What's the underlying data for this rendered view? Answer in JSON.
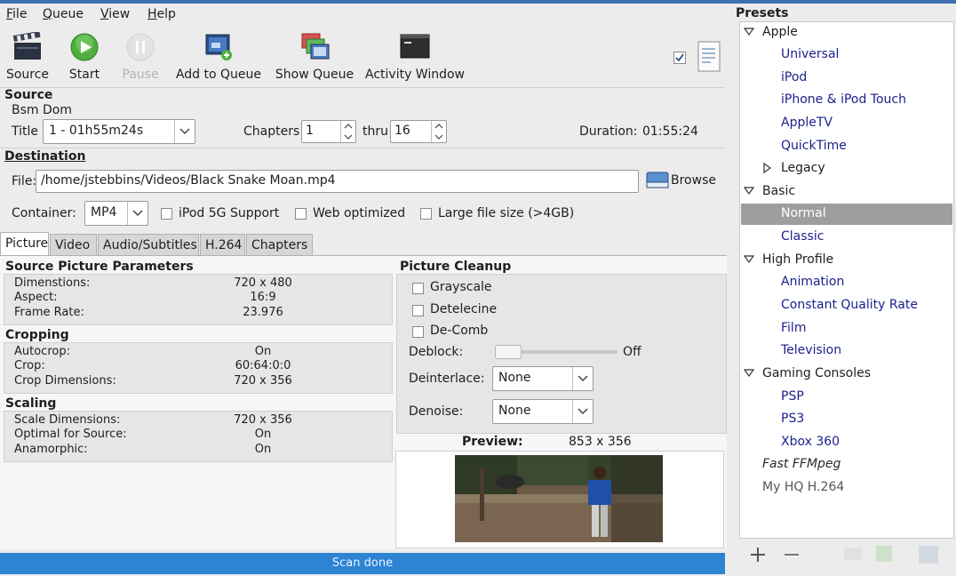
{
  "menu": {
    "file": "File",
    "queue": "Queue",
    "view": "View",
    "help": "Help"
  },
  "toolbar": {
    "source": "Source",
    "start": "Start",
    "pause": "Pause",
    "add_to_queue": "Add to Queue",
    "show_queue": "Show Queue",
    "activity_window": "Activity Window"
  },
  "source": {
    "heading": "Source",
    "name": "Bsm Dom",
    "title_label": "Title",
    "title_value": "1 - 01h55m24s",
    "chapters_label": "Chapters",
    "chapters_from": "1",
    "thru_label": "thru",
    "chapters_to": "16",
    "duration_label": "Duration:",
    "duration_value": "01:55:24"
  },
  "destination": {
    "heading": "Destination",
    "file_label": "File:",
    "file_value": "/home/jstebbins/Videos/Black Snake Moan.mp4",
    "browse_label": "Browse",
    "container_label": "Container:",
    "container_value": "MP4",
    "ipod_label": "iPod 5G Support",
    "web_label": "Web optimized",
    "large_label": "Large file size (>4GB)"
  },
  "tabs": [
    "Picture",
    "Video",
    "Audio/Subtitles",
    "H.264",
    "Chapters"
  ],
  "picture": {
    "source_params": {
      "heading": "Source Picture Parameters",
      "rows": [
        {
          "label": "Dimenstions:",
          "value": "720 x 480"
        },
        {
          "label": "Aspect:",
          "value": "16:9"
        },
        {
          "label": "Frame Rate:",
          "value": "23.976"
        }
      ]
    },
    "cropping": {
      "heading": "Cropping",
      "rows": [
        {
          "label": "Autocrop:",
          "value": "On"
        },
        {
          "label": "Crop:",
          "value": "60:64:0:0"
        },
        {
          "label": "Crop Dimensions:",
          "value": "720 x 356"
        }
      ]
    },
    "scaling": {
      "heading": "Scaling",
      "rows": [
        {
          "label": "Scale Dimensions:",
          "value": "720 x 356"
        },
        {
          "label": "Optimal for Source:",
          "value": "On"
        },
        {
          "label": "Anamorphic:",
          "value": "On"
        }
      ]
    },
    "cleanup": {
      "heading": "Picture Cleanup",
      "grayscale": "Grayscale",
      "detelecine": "Detelecine",
      "decomb": "De-Comb",
      "deblock_label": "Deblock:",
      "deblock_value": "Off",
      "deinterlace_label": "Deinterlace:",
      "deinterlace_value": "None",
      "denoise_label": "Denoise:",
      "denoise_value": "None"
    },
    "preview": {
      "label": "Preview:",
      "size": "853 x 356"
    }
  },
  "status": {
    "text": "Scan done"
  },
  "presets": {
    "heading": "Presets",
    "items": [
      {
        "label": "Apple",
        "type": "group"
      },
      {
        "label": "Universal",
        "type": "child"
      },
      {
        "label": "iPod",
        "type": "child"
      },
      {
        "label": "iPhone & iPod Touch",
        "type": "child"
      },
      {
        "label": "AppleTV",
        "type": "child"
      },
      {
        "label": "QuickTime",
        "type": "child"
      },
      {
        "label": "Legacy",
        "type": "subgroup"
      },
      {
        "label": "Basic",
        "type": "group"
      },
      {
        "label": "Normal",
        "type": "selected"
      },
      {
        "label": "Classic",
        "type": "child"
      },
      {
        "label": "High Profile",
        "type": "group"
      },
      {
        "label": "Animation",
        "type": "child"
      },
      {
        "label": "Constant Quality Rate",
        "type": "child"
      },
      {
        "label": "Film",
        "type": "child"
      },
      {
        "label": "Television",
        "type": "child"
      },
      {
        "label": "Gaming Consoles",
        "type": "group"
      },
      {
        "label": "PSP",
        "type": "child"
      },
      {
        "label": "PS3",
        "type": "child"
      },
      {
        "label": "Xbox 360",
        "type": "child"
      },
      {
        "label": "Fast FFMpeg",
        "type": "custom"
      },
      {
        "label": "My HQ H.264",
        "type": "custom2"
      }
    ],
    "add_icon": "plus-icon",
    "remove_icon": "minus-icon"
  },
  "colors": {
    "accent": "#2c84d3",
    "selected_row": "#9e9e9e",
    "preset_link": "#1a1f8a"
  }
}
